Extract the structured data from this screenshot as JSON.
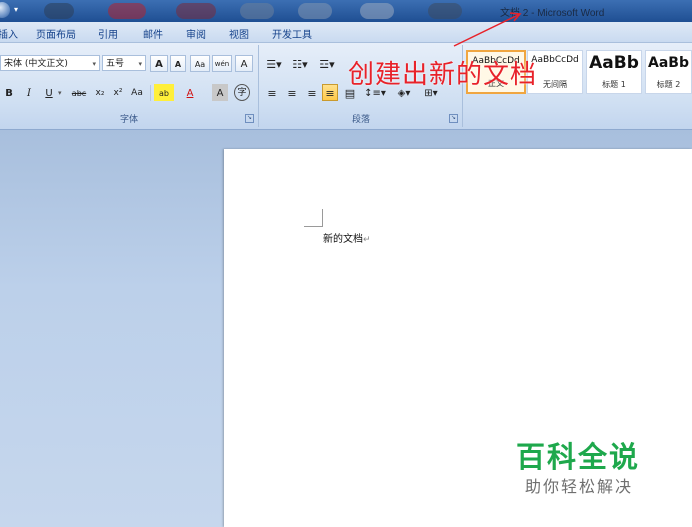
{
  "window": {
    "title": "文档 2 - Microsoft Word"
  },
  "tabs": [
    "插入",
    "页面布局",
    "引用",
    "邮件",
    "审阅",
    "视图",
    "开发工具"
  ],
  "font_group": {
    "font_name": "宋体 (中文正文)",
    "font_size": "五号",
    "grow_font": "A",
    "shrink_font": "A",
    "clear_format": "Aa",
    "phonetic": "wén",
    "char_border": "A",
    "bold": "B",
    "italic": "I",
    "underline": "U",
    "strikethrough": "abc",
    "subscript": "x₂",
    "superscript": "x²",
    "change_case": "Aa",
    "highlight": "ab",
    "font_color": "A",
    "char_shading": "A",
    "enclose": "字",
    "label": "字体"
  },
  "paragraph_group": {
    "label": "段落"
  },
  "styles": [
    {
      "sample": "AaBbCcDd",
      "name": "正文"
    },
    {
      "sample": "AaBbCcDd",
      "name": "无间隔"
    },
    {
      "sample": "AaBb",
      "name": "标题 1"
    },
    {
      "sample": "AaBb",
      "name": "标题 2"
    }
  ],
  "document": {
    "text": "新的文档",
    "para_mark": "↵"
  },
  "annotation": {
    "text": "创建出新的文档"
  },
  "watermark": {
    "title": "百科全说",
    "subtitle": "助你轻松解决"
  },
  "colors": {
    "annotation": "#e8222a",
    "watermark_green": "#1ea84c",
    "ribbon_text": "#15428b"
  }
}
